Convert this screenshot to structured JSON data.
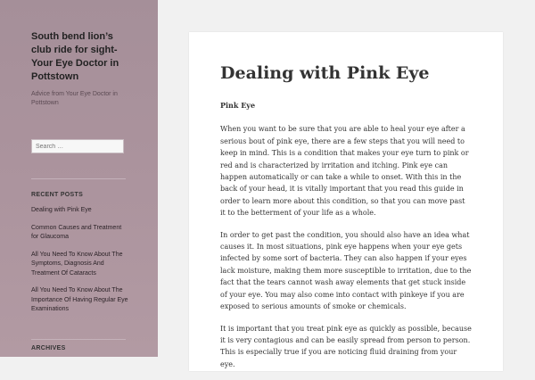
{
  "site": {
    "title": "South bend lion’s club ride for sight-Your Eye Doctor in Pottstown",
    "description": "Advice from Your Eye Doctor in Pottstown"
  },
  "search": {
    "placeholder": "Search …"
  },
  "recent_posts": {
    "title": "RECENT POSTS",
    "items": [
      "Dealing with Pink Eye",
      "Common Causes and Treatment for Glaucoma",
      "All You Need To Know About The Symptoms, Diagnosis And Treatment Of Cataracts",
      "All You Need To Know About The Importance Of Having Regular Eye Examinations"
    ]
  },
  "archives": {
    "title": "ARCHIVES"
  },
  "article": {
    "title": "Dealing with Pink Eye",
    "subheading": "Pink Eye",
    "paragraphs": [
      "When you want to be sure that you are able to heal your eye after a serious bout of pink eye, there are a few steps that you will need to keep in mind. This is a condition that makes your eye turn to pink or red and is characterized by irritation and itching. Pink eye can happen automatically or can take a while to onset. With this in the back of your head, it is vitally important that you read this guide in order to learn more about this condition, so that you can move past it to the betterment of your life as a whole.",
      "In order to get past the condition, you should also have an idea what causes it. In most situations, pink eye happens when your eye gets infected by some sort of bacteria. They can also happen if your eyes lack moisture, making them more susceptible to irritation, due to the fact that the tears cannot wash away elements that get stuck inside of your eye. You may also come into contact with pinkeye if you are exposed to serious amounts of smoke or chemicals.",
      "It is important that you treat pink eye as quickly as possible, because it is very contagious and can be easily spread from person to person. This is especially true if you are noticing fluid draining from your eye."
    ]
  }
}
